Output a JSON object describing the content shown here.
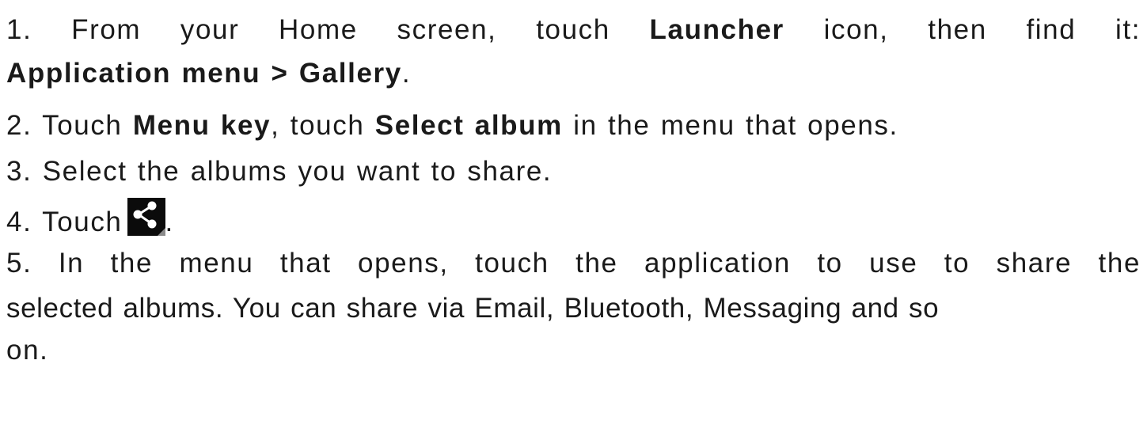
{
  "steps": {
    "s1": {
      "num": "1.",
      "t1": "From your Home screen, touch",
      "b1": "Launcher",
      "t2": "icon, then find it:",
      "b2": "Application menu > Gallery",
      "t3": "."
    },
    "s2": {
      "num": "2.",
      "t1": "Touch",
      "b1": "Menu key",
      "t2": ", touch",
      "b2": "Select album",
      "t3": "in the menu that opens."
    },
    "s3": {
      "num": "3.",
      "t1": "Select the albums you want to share."
    },
    "s4": {
      "num": "4.",
      "t1": "Touch",
      "icon": "share-icon",
      "t2": "."
    },
    "s5": {
      "num": "5.",
      "line1": "In the menu that opens, touch the application to use to share the",
      "line2": "selected albums. You can share via Email, Bluetooth, Messaging and so",
      "line3": "on."
    }
  }
}
